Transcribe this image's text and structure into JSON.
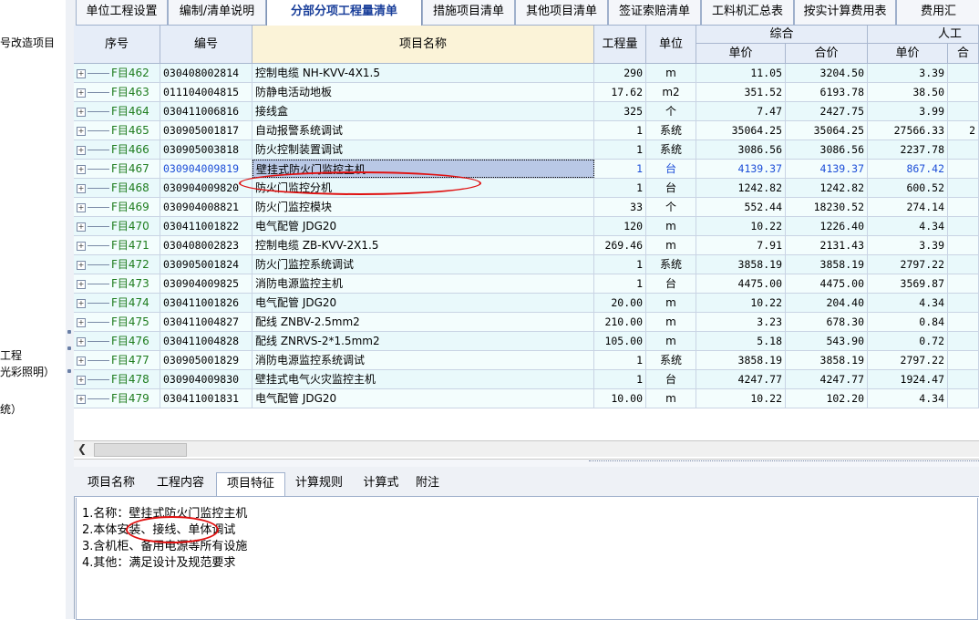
{
  "left_panel": {
    "lines": [
      "号改造项目",
      "工程",
      "光彩照明）",
      "统）"
    ]
  },
  "tabs": [
    "单位工程设置",
    "编制/清单说明",
    "分部分项工程量清单",
    "措施项目清单",
    "其他项目清单",
    "签证索赔清单",
    "工料机汇总表",
    "按实计算费用表",
    "费用汇"
  ],
  "active_tab": 2,
  "grid": {
    "headers": {
      "seq": "序号",
      "code": "编号",
      "name": "项目名称",
      "qty": "工程量",
      "unit": "单位",
      "composite": "综合",
      "labor": "人工",
      "unit_price": "单价",
      "total_price": "合价",
      "labor_unit_price": "单价",
      "labor_partial": "合"
    },
    "rows": [
      {
        "seq": "F目462",
        "code": "030408002814",
        "name": "控制电缆 NH-KVV-4X1.5",
        "qty": "290",
        "unit": "m",
        "unit_price": "11.05",
        "total": "3204.50",
        "labor": "3.39",
        "extra": ""
      },
      {
        "seq": "F目463",
        "code": "011104004815",
        "name": "防静电活动地板",
        "qty": "17.62",
        "unit": "m2",
        "unit_price": "351.52",
        "total": "6193.78",
        "labor": "38.50",
        "extra": ""
      },
      {
        "seq": "F目464",
        "code": "030411006816",
        "name": "接线盒",
        "qty": "325",
        "unit": "个",
        "unit_price": "7.47",
        "total": "2427.75",
        "labor": "3.99",
        "extra": ""
      },
      {
        "seq": "F目465",
        "code": "030905001817",
        "name": "自动报警系统调试",
        "qty": "1",
        "unit": "系统",
        "unit_price": "35064.25",
        "total": "35064.25",
        "labor": "27566.33",
        "extra": "2"
      },
      {
        "seq": "F目466",
        "code": "030905003818",
        "name": "防火控制装置调试",
        "qty": "1",
        "unit": "系统",
        "unit_price": "3086.56",
        "total": "3086.56",
        "labor": "2237.78",
        "extra": ""
      },
      {
        "seq": "F目467",
        "code": "030904009819",
        "name": "壁挂式防火门监控主机",
        "qty": "1",
        "unit": "台",
        "unit_price": "4139.37",
        "total": "4139.37",
        "labor": "867.42",
        "extra": ""
      },
      {
        "seq": "F目468",
        "code": "030904009820",
        "name": "防火门监控分机",
        "qty": "1",
        "unit": "台",
        "unit_price": "1242.82",
        "total": "1242.82",
        "labor": "600.52",
        "extra": ""
      },
      {
        "seq": "F目469",
        "code": "030904008821",
        "name": "防火门监控模块",
        "qty": "33",
        "unit": "个",
        "unit_price": "552.44",
        "total": "18230.52",
        "labor": "274.14",
        "extra": ""
      },
      {
        "seq": "F目470",
        "code": "030411001822",
        "name": "电气配管 JDG20",
        "qty": "120",
        "unit": "m",
        "unit_price": "10.22",
        "total": "1226.40",
        "labor": "4.34",
        "extra": ""
      },
      {
        "seq": "F目471",
        "code": "030408002823",
        "name": "控制电缆 ZB-KVV-2X1.5",
        "qty": "269.46",
        "unit": "m",
        "unit_price": "7.91",
        "total": "2131.43",
        "labor": "3.39",
        "extra": ""
      },
      {
        "seq": "F目472",
        "code": "030905001824",
        "name": "防火门监控系统调试",
        "qty": "1",
        "unit": "系统",
        "unit_price": "3858.19",
        "total": "3858.19",
        "labor": "2797.22",
        "extra": ""
      },
      {
        "seq": "F目473",
        "code": "030904009825",
        "name": "消防电源监控主机",
        "qty": "1",
        "unit": "台",
        "unit_price": "4475.00",
        "total": "4475.00",
        "labor": "3569.87",
        "extra": ""
      },
      {
        "seq": "F目474",
        "code": "030411001826",
        "name": "电气配管 JDG20",
        "qty": "20.00",
        "unit": "m",
        "unit_price": "10.22",
        "total": "204.40",
        "labor": "4.34",
        "extra": ""
      },
      {
        "seq": "F目475",
        "code": "030411004827",
        "name": "配线 ZNBV-2.5mm2",
        "qty": "210.00",
        "unit": "m",
        "unit_price": "3.23",
        "total": "678.30",
        "labor": "0.84",
        "extra": ""
      },
      {
        "seq": "F目476",
        "code": "030411004828",
        "name": "配线 ZNRVS-2*1.5mm2",
        "qty": "105.00",
        "unit": "m",
        "unit_price": "5.18",
        "total": "543.90",
        "labor": "0.72",
        "extra": ""
      },
      {
        "seq": "F目477",
        "code": "030905001829",
        "name": "消防电源监控系统调试",
        "qty": "1",
        "unit": "系统",
        "unit_price": "3858.19",
        "total": "3858.19",
        "labor": "2797.22",
        "extra": ""
      },
      {
        "seq": "F目478",
        "code": "030904009830",
        "name": "壁挂式电气火灾监控主机",
        "qty": "1",
        "unit": "台",
        "unit_price": "4247.77",
        "total": "4247.77",
        "labor": "1924.47",
        "extra": ""
      },
      {
        "seq": "F目479",
        "code": "030411001831",
        "name": "电气配管 JDG20",
        "qty": "10.00",
        "unit": "m",
        "unit_price": "10.22",
        "total": "102.20",
        "labor": "4.34",
        "extra": ""
      }
    ],
    "selected_row": 5
  },
  "bottom_tabs": [
    "项目名称",
    "工程内容",
    "项目特征",
    "计算规则",
    "计算式",
    "附注"
  ],
  "active_bottom_tab": 2,
  "detail_lines": [
    "1.名称：壁挂式防火门监控主机",
    "2.本体安装、接线、单体调试",
    "3.含机柜、备用电源等所有设施",
    "4.其他：满足设计及规范要求"
  ],
  "colors": {
    "annotation": "#e01010",
    "active_tab_text": "#1a3f9a",
    "seq_green": "#1f7d1f",
    "selected_blue": "#1d4ed8"
  },
  "icons": [
    "expand-icon",
    "scroll-left-arrow-icon",
    "splitter-grip-icon"
  ]
}
